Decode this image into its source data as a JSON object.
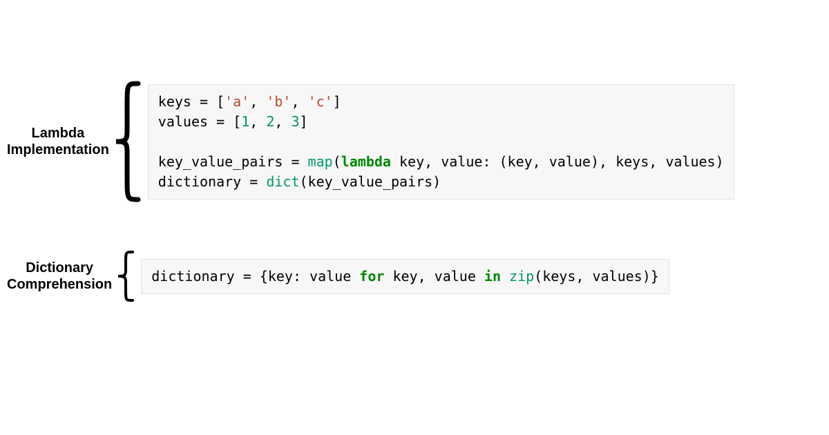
{
  "sections": {
    "lambda": {
      "label": "Lambda\nImplementation",
      "code": {
        "line1": {
          "asgn1": "keys = [",
          "s_a": "'a'",
          "c1": ", ",
          "s_b": "'b'",
          "c2": ", ",
          "s_c": "'c'",
          "close1": "]"
        },
        "line2": {
          "asgn2": "values = [",
          "n1": "1",
          "c3": ", ",
          "n2": "2",
          "c4": ", ",
          "n3": "3",
          "close2": "]"
        },
        "line4": {
          "asgn3": "key_value_pairs = ",
          "map": "map",
          "open": "(",
          "lambda": "lambda",
          "args": " key, value: (key, value), keys, values)"
        },
        "line5": {
          "asgn4": "dictionary = ",
          "dict": "dict",
          "tail": "(key_value_pairs)"
        }
      }
    },
    "comp": {
      "label": "Dictionary\nComprehension",
      "code": {
        "line1": {
          "asgn": "dictionary = {key: value ",
          "for": "for",
          "mid": " key, value ",
          "in": "in",
          "sp": " ",
          "zip": "zip",
          "tail": "(keys, values)}"
        }
      }
    }
  }
}
